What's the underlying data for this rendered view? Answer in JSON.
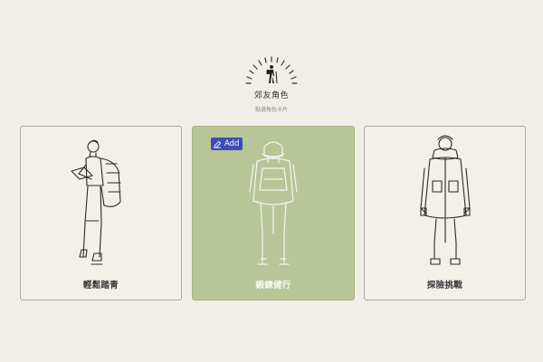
{
  "header": {
    "icon": "hiker-sun-icon",
    "title": "郊友角色",
    "subtitle": "點選角色卡片"
  },
  "cards": [
    {
      "label": "輕鬆踏青",
      "icon": "hiker-backpack-reading-icon",
      "selected": false
    },
    {
      "label": "鍛鍊健行",
      "icon": "hiker-back-view-icon",
      "selected": true
    },
    {
      "label": "探險挑戰",
      "icon": "explorer-winter-jacket-icon",
      "selected": false
    }
  ],
  "add_button": {
    "label": "Add",
    "icon": "pencil-icon"
  },
  "colors": {
    "background": "#f1eee8",
    "selected_card": "#b8c597",
    "add_button": "#3d4db3"
  }
}
